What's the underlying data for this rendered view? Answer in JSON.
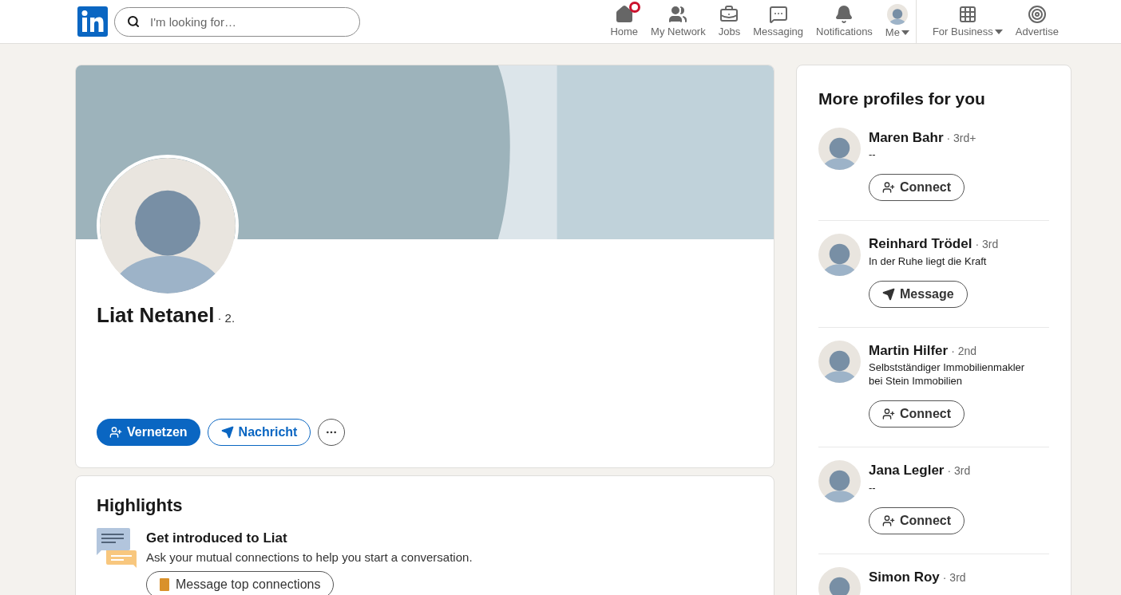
{
  "header": {
    "search": {
      "placeholder": "I'm looking for…"
    },
    "nav": [
      {
        "kind": "home",
        "label": "Home",
        "badge": true,
        "caret": false
      },
      {
        "kind": "network",
        "label": "My Network",
        "badge": false,
        "caret": false
      },
      {
        "kind": "jobs",
        "label": "Jobs",
        "badge": false,
        "caret": false
      },
      {
        "kind": "messaging",
        "label": "Messaging",
        "badge": false,
        "caret": false
      },
      {
        "kind": "notifications",
        "label": "Notifications",
        "badge": false,
        "caret": false
      },
      {
        "kind": "me",
        "label": "Me",
        "badge": false,
        "caret": true
      },
      {
        "kind": "business",
        "label": "For Business",
        "badge": false,
        "caret": true
      },
      {
        "kind": "advertise",
        "label": "Advertise",
        "badge": false,
        "caret": false
      }
    ]
  },
  "profile": {
    "name": "Liat Netanel",
    "degree": "· 2.",
    "actions": [
      {
        "kind": "primary",
        "label": "Vernetzen"
      },
      {
        "kind": "outline",
        "label": "Nachricht"
      },
      {
        "kind": "more"
      }
    ]
  },
  "highlights": {
    "title": "Highlights",
    "item": {
      "title": "Get introduced to Liat",
      "text": "Ask your mutual connections to help you start a conversation.",
      "button": "Message top connections"
    }
  },
  "sidebar": {
    "title": "More profiles for you",
    "profiles": [
      {
        "name": "Maren Bahr",
        "degree": "· 3rd+",
        "headline": "--",
        "action": {
          "kind": "connect",
          "label": "Connect"
        }
      },
      {
        "name": "Reinhard Trödel",
        "degree": "· 3rd",
        "headline": "In der Ruhe liegt die Kraft",
        "action": {
          "kind": "message",
          "label": "Message"
        }
      },
      {
        "name": "Martin Hilfer",
        "degree": "· 2nd",
        "headline": "Selbstständiger Immobilienmakler bei Stein Immobilien",
        "action": {
          "kind": "connect",
          "label": "Connect"
        }
      },
      {
        "name": "Jana Legler",
        "degree": "· 3rd",
        "headline": "--",
        "action": {
          "kind": "connect",
          "label": "Connect"
        }
      },
      {
        "name": "Simon Roy",
        "degree": "· 3rd"
      }
    ]
  }
}
